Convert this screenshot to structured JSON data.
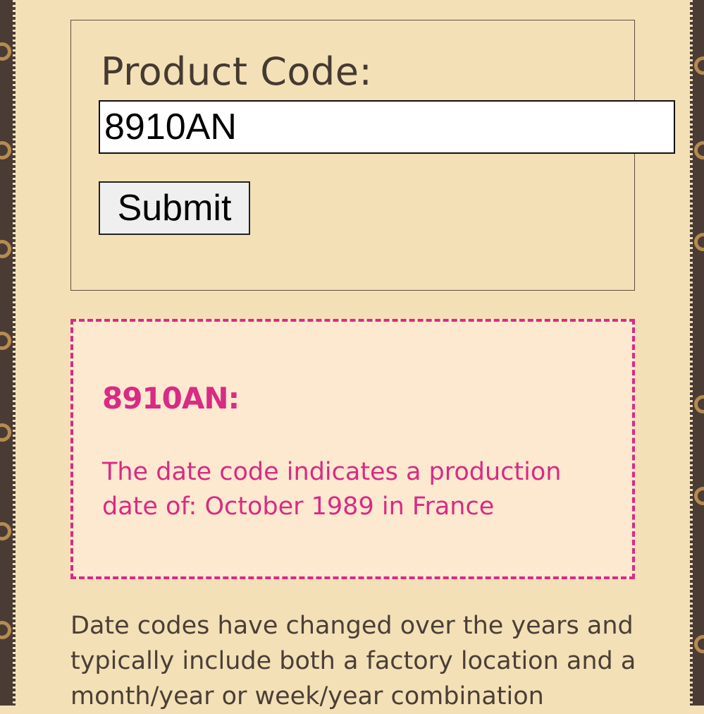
{
  "form": {
    "label": "Product Code:",
    "input_value": "8910AN",
    "submit_label": "Submit"
  },
  "result": {
    "title": "8910AN:",
    "text": "The date code indicates a production date of: October 1989 in France"
  },
  "info": {
    "text": "Date codes have changed over the years and typically include both a factory location and a month/year or week/year combination"
  },
  "colors": {
    "background": "#f4e0b7",
    "accent_pink": "#d92a84",
    "border_brown": "#4a3b35",
    "motif_gold": "#b58b52"
  }
}
